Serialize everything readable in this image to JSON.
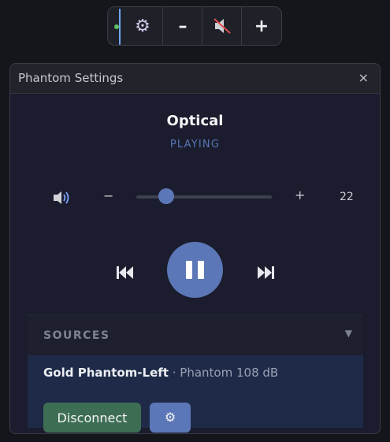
{
  "toolbar": {
    "status_color": "#5ec267",
    "buttons": [
      {
        "name": "settings",
        "icon": "gear-icon",
        "glyph": "⚙"
      },
      {
        "name": "volume-down",
        "icon": "minus-icon",
        "glyph": "–"
      },
      {
        "name": "mute",
        "icon": "speaker-muted-icon",
        "glyph": ""
      },
      {
        "name": "volume-up",
        "icon": "plus-icon",
        "glyph": "+"
      }
    ]
  },
  "panel": {
    "title": "Phantom Settings",
    "close_glyph": "×"
  },
  "device": {
    "name": "Optical",
    "state": "PLAYING"
  },
  "volume": {
    "icon": "speaker-icon",
    "minus": "−",
    "plus": "+",
    "value": "22",
    "level": 0.22
  },
  "transport": {
    "prev_icon": "skip-previous-icon",
    "play_icon": "pause-icon",
    "next_icon": "skip-next-icon"
  },
  "sources": {
    "label": "SOURCES",
    "chevron": "▼",
    "items": [
      {
        "name": "Gold Phantom-Left",
        "separator": "·",
        "detail": "Phantom 108 dB",
        "disconnect_label": "Disconnect",
        "settings_glyph": "⚙"
      }
    ]
  },
  "colors": {
    "accent": "#5c77b7",
    "success": "#3d6d53",
    "background": "#1b1d2e"
  }
}
